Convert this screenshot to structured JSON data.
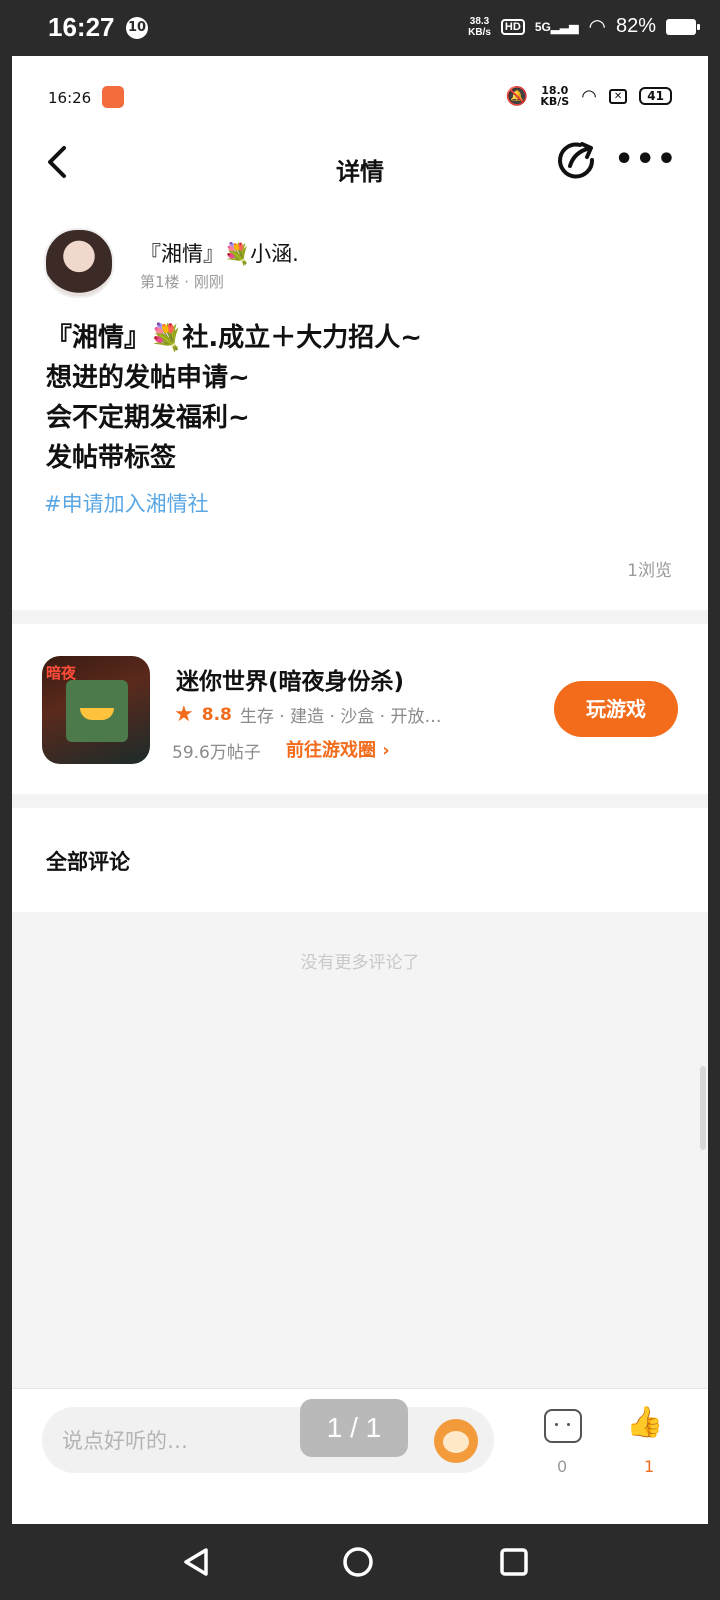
{
  "outer_status": {
    "time": "16:27",
    "badge": "10",
    "speed_value": "38.3",
    "speed_unit": "KB/s",
    "hd": "HD",
    "network": "5G",
    "battery": "82%"
  },
  "inner_status": {
    "time": "16:26",
    "speed_value": "18.0",
    "speed_unit": "KB/S",
    "battery": "41"
  },
  "header": {
    "title": "详情"
  },
  "post": {
    "author": "『湘情』💐小涵.",
    "meta": "第1楼 · 刚刚",
    "lines": [
      "『湘情』💐社.成立＋大力招人~",
      "想进的发帖申请~",
      "会不定期发福利~",
      "发帖带标签"
    ],
    "tag": "#申请加入湘情社",
    "views": "1浏览"
  },
  "game": {
    "icon_label": "暗夜",
    "title": "迷你世界(暗夜身份杀)",
    "rating": "8.8",
    "genres": "生存 · 建造 · 沙盒 · 开放…",
    "posts": "59.6万帖子",
    "link": "前往游戏圈 ›",
    "play_button": "玩游戏"
  },
  "comments": {
    "title": "全部评论",
    "empty_text": "没有更多评论了"
  },
  "bottom_bar": {
    "placeholder": "说点好听的…",
    "comment_count": "0",
    "like_count": "1",
    "page_indicator": "1 / 1"
  },
  "colors": {
    "accent": "#f26c1c",
    "tag": "#5ba7e4"
  }
}
